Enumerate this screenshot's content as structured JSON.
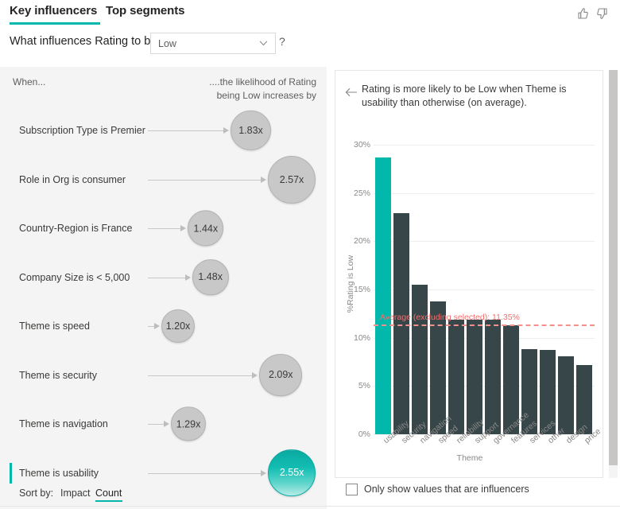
{
  "header": {
    "tabs": [
      {
        "label": "Key influencers",
        "selected": true
      },
      {
        "label": "Top segments",
        "selected": false
      }
    ],
    "feedback": {
      "thumbs_up": "thumbs-up-icon",
      "thumbs_down": "thumbs-down-icon"
    }
  },
  "question": {
    "label": "What influences Rating to be",
    "selected_value": "Low",
    "options": [
      "Low"
    ],
    "help": "?"
  },
  "left_panel": {
    "when_header": "When...",
    "likelihood_header": "....the likelihood of Rating being Low increases by",
    "influencers": [
      {
        "label": "Subscription Type is Premier",
        "value": "1.83x",
        "selected": false
      },
      {
        "label": "Role in Org is consumer",
        "value": "2.57x",
        "selected": false
      },
      {
        "label": "Country-Region is France",
        "value": "1.44x",
        "selected": false
      },
      {
        "label": "Company Size is < 5,000",
        "value": "1.48x",
        "selected": false
      },
      {
        "label": "Theme is speed",
        "value": "1.20x",
        "selected": false
      },
      {
        "label": "Theme is security",
        "value": "2.09x",
        "selected": false
      },
      {
        "label": "Theme is navigation",
        "value": "1.29x",
        "selected": false
      },
      {
        "label": "Theme is usability",
        "value": "2.55x",
        "selected": true
      }
    ],
    "sort": {
      "label": "Sort by:",
      "options": [
        "Impact",
        "Count"
      ],
      "selected": "Count"
    }
  },
  "right_panel": {
    "back_icon": "back-arrow-icon",
    "title": "Rating is more likely to be Low when Theme is usability than otherwise (on average).",
    "checkbox": {
      "label": "Only show values that are influencers",
      "checked": false
    }
  },
  "colors": {
    "accent_teal": "#01b8aa",
    "bar_dark": "#374649",
    "average_line": "#f2706e",
    "bubble_grey": "#c8c8c8",
    "panel_bg": "#f4f4f4"
  },
  "chart_data": {
    "type": "bar",
    "title": "",
    "xlabel": "Theme",
    "ylabel": "%Rating is Low",
    "categories": [
      "usability",
      "security",
      "navigation",
      "speed",
      "reliability",
      "support",
      "governance",
      "features",
      "services",
      "other",
      "design",
      "price"
    ],
    "values": [
      28.7,
      22.9,
      15.5,
      13.8,
      11.9,
      11.9,
      11.9,
      11.3,
      8.8,
      8.7,
      8.1,
      7.2
    ],
    "highlighted_index": 0,
    "ylim": [
      0,
      30
    ],
    "ytick_labels": [
      "0%",
      "5%",
      "10%",
      "15%",
      "20%",
      "25%",
      "30%"
    ],
    "ytick_values": [
      0,
      5,
      10,
      15,
      20,
      25,
      30
    ],
    "grid": true,
    "legend": false,
    "annotations": [
      {
        "type": "average_line",
        "label": "Average (excluding selected): 11.35%",
        "value": 11.35
      }
    ]
  }
}
